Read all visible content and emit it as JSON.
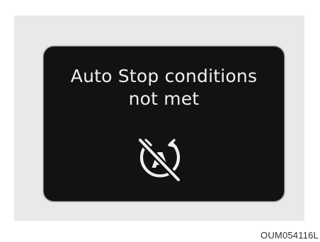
{
  "display": {
    "message_line1": "Auto Stop conditions",
    "message_line2": "not met",
    "icon": "auto-stop-off-icon",
    "icon_letter": "A"
  },
  "figure_code": "OUM054116L",
  "colors": {
    "panel_background": "#121212",
    "text": "#efefef",
    "frame_background": "#e9e9e9"
  }
}
